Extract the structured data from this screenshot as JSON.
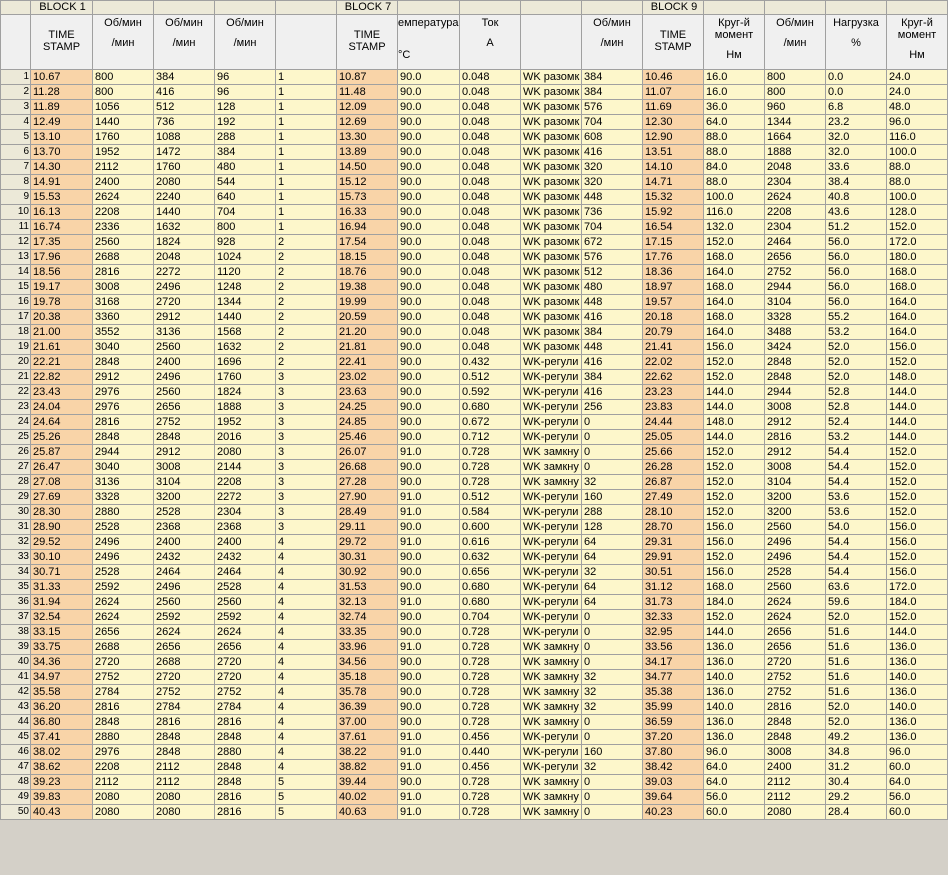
{
  "block_labels": [
    "BLOCK 1",
    "BLOCK 7",
    "BLOCK 9"
  ],
  "headers": [
    {
      "top": "TIME STAMP",
      "bottom": "",
      "ts": true
    },
    {
      "top": "Об/мин",
      "bottom": "/мин"
    },
    {
      "top": "Об/мин",
      "bottom": "/мин"
    },
    {
      "top": "Об/мин",
      "bottom": "/мин"
    },
    {
      "top": "",
      "bottom": ""
    },
    {
      "top": "TIME STAMP",
      "bottom": "",
      "ts": true
    },
    {
      "top": "емпература",
      "bottom": "°C"
    },
    {
      "top": "Ток",
      "bottom": "A"
    },
    {
      "top": "",
      "bottom": ""
    },
    {
      "top": "Об/мин",
      "bottom": "/мин"
    },
    {
      "top": "TIME STAMP",
      "bottom": "",
      "ts": true
    },
    {
      "top": "Круг-й момент",
      "bottom": "Нм"
    },
    {
      "top": "Об/мин",
      "bottom": "/мин"
    },
    {
      "top": "Нагрузка",
      "bottom": "%"
    },
    {
      "top": "Круг-й момент",
      "bottom": "Нм"
    }
  ],
  "rows": [
    [
      "10.67",
      "800",
      "384",
      "96",
      "1",
      "10.87",
      "90.0",
      "0.048",
      "WK разомк",
      "384",
      "10.46",
      "16.0",
      "800",
      "0.0",
      "24.0"
    ],
    [
      "11.28",
      "800",
      "416",
      "96",
      "1",
      "11.48",
      "90.0",
      "0.048",
      "WK разомк",
      "384",
      "11.07",
      "16.0",
      "800",
      "0.0",
      "24.0"
    ],
    [
      "11.89",
      "1056",
      "512",
      "128",
      "1",
      "12.09",
      "90.0",
      "0.048",
      "WK разомк",
      "576",
      "11.69",
      "36.0",
      "960",
      "6.8",
      "48.0"
    ],
    [
      "12.49",
      "1440",
      "736",
      "192",
      "1",
      "12.69",
      "90.0",
      "0.048",
      "WK разомк",
      "704",
      "12.30",
      "64.0",
      "1344",
      "23.2",
      "96.0"
    ],
    [
      "13.10",
      "1760",
      "1088",
      "288",
      "1",
      "13.30",
      "90.0",
      "0.048",
      "WK разомк",
      "608",
      "12.90",
      "88.0",
      "1664",
      "32.0",
      "116.0"
    ],
    [
      "13.70",
      "1952",
      "1472",
      "384",
      "1",
      "13.89",
      "90.0",
      "0.048",
      "WK разомк",
      "416",
      "13.51",
      "88.0",
      "1888",
      "32.0",
      "100.0"
    ],
    [
      "14.30",
      "2112",
      "1760",
      "480",
      "1",
      "14.50",
      "90.0",
      "0.048",
      "WK разомк",
      "320",
      "14.10",
      "84.0",
      "2048",
      "33.6",
      "88.0"
    ],
    [
      "14.91",
      "2400",
      "2080",
      "544",
      "1",
      "15.12",
      "90.0",
      "0.048",
      "WK разомк",
      "320",
      "14.71",
      "88.0",
      "2304",
      "38.4",
      "88.0"
    ],
    [
      "15.53",
      "2624",
      "2240",
      "640",
      "1",
      "15.73",
      "90.0",
      "0.048",
      "WK разомк",
      "448",
      "15.32",
      "100.0",
      "2624",
      "40.8",
      "100.0"
    ],
    [
      "16.13",
      "2208",
      "1440",
      "704",
      "1",
      "16.33",
      "90.0",
      "0.048",
      "WK разомк",
      "736",
      "15.92",
      "116.0",
      "2208",
      "43.6",
      "128.0"
    ],
    [
      "16.74",
      "2336",
      "1632",
      "800",
      "1",
      "16.94",
      "90.0",
      "0.048",
      "WK разомк",
      "704",
      "16.54",
      "132.0",
      "2304",
      "51.2",
      "152.0"
    ],
    [
      "17.35",
      "2560",
      "1824",
      "928",
      "2",
      "17.54",
      "90.0",
      "0.048",
      "WK разомк",
      "672",
      "17.15",
      "152.0",
      "2464",
      "56.0",
      "172.0"
    ],
    [
      "17.96",
      "2688",
      "2048",
      "1024",
      "2",
      "18.15",
      "90.0",
      "0.048",
      "WK разомк",
      "576",
      "17.76",
      "168.0",
      "2656",
      "56.0",
      "180.0"
    ],
    [
      "18.56",
      "2816",
      "2272",
      "1120",
      "2",
      "18.76",
      "90.0",
      "0.048",
      "WK разомк",
      "512",
      "18.36",
      "164.0",
      "2752",
      "56.0",
      "168.0"
    ],
    [
      "19.17",
      "3008",
      "2496",
      "1248",
      "2",
      "19.38",
      "90.0",
      "0.048",
      "WK разомк",
      "480",
      "18.97",
      "168.0",
      "2944",
      "56.0",
      "168.0"
    ],
    [
      "19.78",
      "3168",
      "2720",
      "1344",
      "2",
      "19.99",
      "90.0",
      "0.048",
      "WK разомк",
      "448",
      "19.57",
      "164.0",
      "3104",
      "56.0",
      "164.0"
    ],
    [
      "20.38",
      "3360",
      "2912",
      "1440",
      "2",
      "20.59",
      "90.0",
      "0.048",
      "WK разомк",
      "416",
      "20.18",
      "168.0",
      "3328",
      "55.2",
      "164.0"
    ],
    [
      "21.00",
      "3552",
      "3136",
      "1568",
      "2",
      "21.20",
      "90.0",
      "0.048",
      "WK разомк",
      "384",
      "20.79",
      "164.0",
      "3488",
      "53.2",
      "164.0"
    ],
    [
      "21.61",
      "3040",
      "2560",
      "1632",
      "2",
      "21.81",
      "90.0",
      "0.048",
      "WK разомк",
      "448",
      "21.41",
      "156.0",
      "3424",
      "52.0",
      "156.0"
    ],
    [
      "22.21",
      "2848",
      "2400",
      "1696",
      "2",
      "22.41",
      "90.0",
      "0.432",
      "WK-регули",
      "416",
      "22.02",
      "152.0",
      "2848",
      "52.0",
      "152.0"
    ],
    [
      "22.82",
      "2912",
      "2496",
      "1760",
      "3",
      "23.02",
      "90.0",
      "0.512",
      "WK-регули",
      "384",
      "22.62",
      "152.0",
      "2848",
      "52.0",
      "148.0"
    ],
    [
      "23.43",
      "2976",
      "2560",
      "1824",
      "3",
      "23.63",
      "90.0",
      "0.592",
      "WK-регули",
      "416",
      "23.23",
      "144.0",
      "2944",
      "52.8",
      "144.0"
    ],
    [
      "24.04",
      "2976",
      "2656",
      "1888",
      "3",
      "24.25",
      "90.0",
      "0.680",
      "WK-регули",
      "256",
      "23.83",
      "144.0",
      "3008",
      "52.8",
      "144.0"
    ],
    [
      "24.64",
      "2816",
      "2752",
      "1952",
      "3",
      "24.85",
      "90.0",
      "0.672",
      "WK-регули",
      "0",
      "24.44",
      "148.0",
      "2912",
      "52.4",
      "144.0"
    ],
    [
      "25.26",
      "2848",
      "2848",
      "2016",
      "3",
      "25.46",
      "90.0",
      "0.712",
      "WK-регули",
      "0",
      "25.05",
      "144.0",
      "2816",
      "53.2",
      "144.0"
    ],
    [
      "25.87",
      "2944",
      "2912",
      "2080",
      "3",
      "26.07",
      "91.0",
      "0.728",
      "WK замкну",
      "0",
      "25.66",
      "152.0",
      "2912",
      "54.4",
      "152.0"
    ],
    [
      "26.47",
      "3040",
      "3008",
      "2144",
      "3",
      "26.68",
      "90.0",
      "0.728",
      "WK замкну",
      "0",
      "26.28",
      "152.0",
      "3008",
      "54.4",
      "152.0"
    ],
    [
      "27.08",
      "3136",
      "3104",
      "2208",
      "3",
      "27.28",
      "90.0",
      "0.728",
      "WK замкну",
      "32",
      "26.87",
      "152.0",
      "3104",
      "54.4",
      "152.0"
    ],
    [
      "27.69",
      "3328",
      "3200",
      "2272",
      "3",
      "27.90",
      "91.0",
      "0.512",
      "WK-регули",
      "160",
      "27.49",
      "152.0",
      "3200",
      "53.6",
      "152.0"
    ],
    [
      "28.30",
      "2880",
      "2528",
      "2304",
      "3",
      "28.49",
      "91.0",
      "0.584",
      "WK-регули",
      "288",
      "28.10",
      "152.0",
      "3200",
      "53.6",
      "152.0"
    ],
    [
      "28.90",
      "2528",
      "2368",
      "2368",
      "3",
      "29.11",
      "90.0",
      "0.600",
      "WK-регули",
      "128",
      "28.70",
      "156.0",
      "2560",
      "54.0",
      "156.0"
    ],
    [
      "29.52",
      "2496",
      "2400",
      "2400",
      "4",
      "29.72",
      "91.0",
      "0.616",
      "WK-регули",
      "64",
      "29.31",
      "156.0",
      "2496",
      "54.4",
      "156.0"
    ],
    [
      "30.10",
      "2496",
      "2432",
      "2432",
      "4",
      "30.31",
      "90.0",
      "0.632",
      "WK-регули",
      "64",
      "29.91",
      "152.0",
      "2496",
      "54.4",
      "152.0"
    ],
    [
      "30.71",
      "2528",
      "2464",
      "2464",
      "4",
      "30.92",
      "90.0",
      "0.656",
      "WK-регули",
      "32",
      "30.51",
      "156.0",
      "2528",
      "54.4",
      "156.0"
    ],
    [
      "31.33",
      "2592",
      "2496",
      "2528",
      "4",
      "31.53",
      "90.0",
      "0.680",
      "WK-регули",
      "64",
      "31.12",
      "168.0",
      "2560",
      "63.6",
      "172.0"
    ],
    [
      "31.94",
      "2624",
      "2560",
      "2560",
      "4",
      "32.13",
      "91.0",
      "0.680",
      "WK-регули",
      "64",
      "31.73",
      "184.0",
      "2624",
      "59.6",
      "184.0"
    ],
    [
      "32.54",
      "2624",
      "2592",
      "2592",
      "4",
      "32.74",
      "90.0",
      "0.704",
      "WK-регули",
      "0",
      "32.33",
      "152.0",
      "2624",
      "52.0",
      "152.0"
    ],
    [
      "33.15",
      "2656",
      "2624",
      "2624",
      "4",
      "33.35",
      "90.0",
      "0.728",
      "WK-регули",
      "0",
      "32.95",
      "144.0",
      "2656",
      "51.6",
      "144.0"
    ],
    [
      "33.75",
      "2688",
      "2656",
      "2656",
      "4",
      "33.96",
      "91.0",
      "0.728",
      "WK замкну",
      "0",
      "33.56",
      "136.0",
      "2656",
      "51.6",
      "136.0"
    ],
    [
      "34.36",
      "2720",
      "2688",
      "2720",
      "4",
      "34.56",
      "90.0",
      "0.728",
      "WK замкну",
      "0",
      "34.17",
      "136.0",
      "2720",
      "51.6",
      "136.0"
    ],
    [
      "34.97",
      "2752",
      "2720",
      "2720",
      "4",
      "35.18",
      "90.0",
      "0.728",
      "WK замкну",
      "32",
      "34.77",
      "140.0",
      "2752",
      "51.6",
      "140.0"
    ],
    [
      "35.58",
      "2784",
      "2752",
      "2752",
      "4",
      "35.78",
      "90.0",
      "0.728",
      "WK замкну",
      "32",
      "35.38",
      "136.0",
      "2752",
      "51.6",
      "136.0"
    ],
    [
      "36.20",
      "2816",
      "2784",
      "2784",
      "4",
      "36.39",
      "90.0",
      "0.728",
      "WK замкну",
      "32",
      "35.99",
      "140.0",
      "2816",
      "52.0",
      "140.0"
    ],
    [
      "36.80",
      "2848",
      "2816",
      "2816",
      "4",
      "37.00",
      "90.0",
      "0.728",
      "WK замкну",
      "0",
      "36.59",
      "136.0",
      "2848",
      "52.0",
      "136.0"
    ],
    [
      "37.41",
      "2880",
      "2848",
      "2848",
      "4",
      "37.61",
      "91.0",
      "0.456",
      "WK-регули",
      "0",
      "37.20",
      "136.0",
      "2848",
      "49.2",
      "136.0"
    ],
    [
      "38.02",
      "2976",
      "2848",
      "2880",
      "4",
      "38.22",
      "91.0",
      "0.440",
      "WK-регули",
      "160",
      "37.80",
      "96.0",
      "3008",
      "34.8",
      "96.0"
    ],
    [
      "38.62",
      "2208",
      "2112",
      "2848",
      "4",
      "38.82",
      "91.0",
      "0.456",
      "WK-регули",
      "32",
      "38.42",
      "64.0",
      "2400",
      "31.2",
      "60.0"
    ],
    [
      "39.23",
      "2112",
      "2112",
      "2848",
      "5",
      "39.44",
      "90.0",
      "0.728",
      "WK замкну",
      "0",
      "39.03",
      "64.0",
      "2112",
      "30.4",
      "64.0"
    ],
    [
      "39.83",
      "2080",
      "2080",
      "2816",
      "5",
      "40.02",
      "91.0",
      "0.728",
      "WK замкну",
      "0",
      "39.64",
      "56.0",
      "2112",
      "29.2",
      "56.0"
    ],
    [
      "40.43",
      "2080",
      "2080",
      "2816",
      "5",
      "40.63",
      "91.0",
      "0.728",
      "WK замкну",
      "0",
      "40.23",
      "60.0",
      "2080",
      "28.4",
      "60.0"
    ]
  ]
}
